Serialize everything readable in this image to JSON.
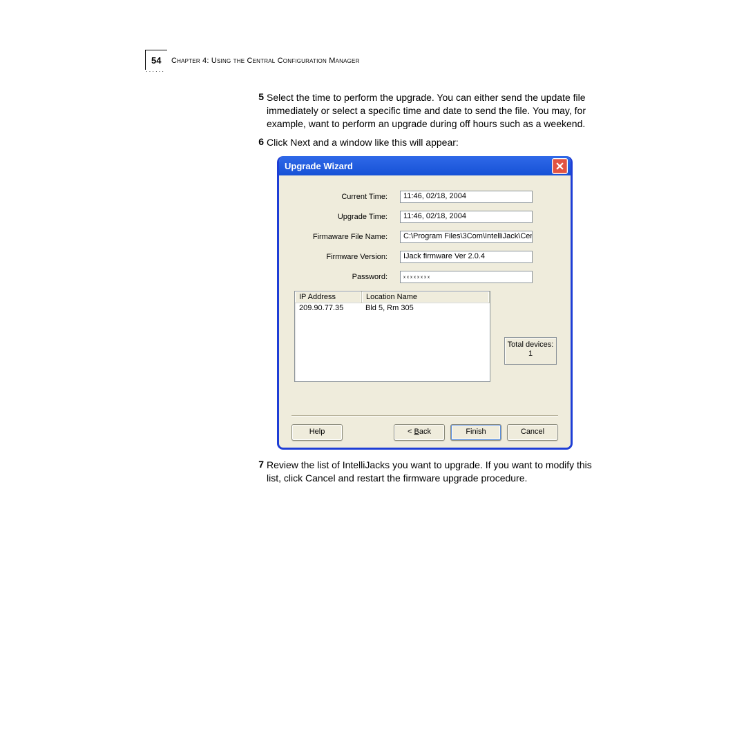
{
  "header": {
    "page_number": "54",
    "chapter": "Chapter 4: Using the Central Configuration Manager"
  },
  "steps": [
    {
      "num": "5",
      "text": "Select the time to perform the upgrade. You can either send the update file immediately or select a specific time and date to send the file. You may, for example, want to perform an upgrade during off hours such as a weekend."
    },
    {
      "num": "6",
      "text": "Click Next and a window like this will appear:"
    },
    {
      "num": "7",
      "text": "Review the list of IntelliJacks you want to upgrade. If you want to modify this list, click Cancel and restart the firmware upgrade procedure."
    }
  ],
  "dialog": {
    "title": "Upgrade Wizard",
    "labels": {
      "current_time": "Current Time:",
      "upgrade_time": "Upgrade Time:",
      "firmware_file": "Firmaware File Name:",
      "firmware_version": "Firmware Version:",
      "password": "Password:"
    },
    "values": {
      "current_time": "11:46, 02/18, 2004",
      "upgrade_time": "11:46, 02/18, 2004",
      "firmware_file": "C:\\Program Files\\3Com\\IntelliJack\\Cent",
      "firmware_version": "IJack firmware Ver 2.0.4",
      "password": "xxxxxxxx"
    },
    "table": {
      "headers": [
        "IP Address",
        "Location Name"
      ],
      "rows": [
        {
          "ip": "209.90.77.35",
          "location": "Bld 5, Rm 305"
        }
      ]
    },
    "total": {
      "label": "Total devices:",
      "count": "1"
    },
    "buttons": {
      "help": "Help",
      "back_key": "B",
      "back_rest": "ack",
      "finish": "Finish",
      "cancel": "Cancel"
    }
  }
}
